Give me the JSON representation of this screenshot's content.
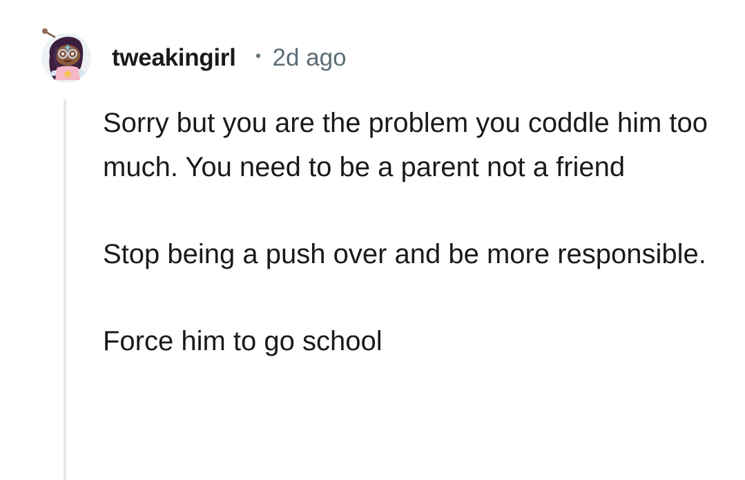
{
  "comment": {
    "author": "tweakingirl",
    "separator": "•",
    "timestamp": "2d ago",
    "paragraphs": [
      "Sorry but you are the problem you coddle him too much. You need to be a parent not a friend",
      "Stop being a push over and be more responsible.",
      "Force him to go school"
    ]
  },
  "icons": {
    "avatar": "snoo-avatar-icon"
  },
  "colors": {
    "text": "#1a1a1b",
    "meta": "#5c6b73",
    "thread_line": "#e5e7e9"
  }
}
